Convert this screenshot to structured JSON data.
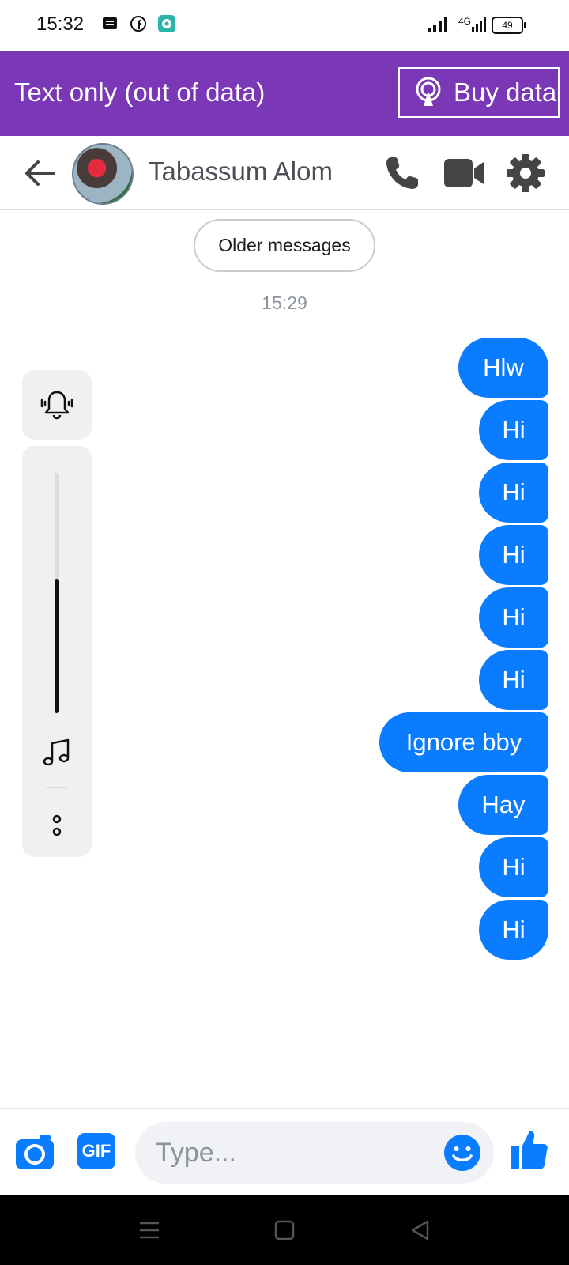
{
  "status_bar": {
    "time": "15:32",
    "network": "4G",
    "battery": "49"
  },
  "banner": {
    "text": "Text only (out of data)",
    "button_label": "Buy data",
    "color": "#7a37b6"
  },
  "header": {
    "contact_name": "Tabassum Alom",
    "icons": [
      "back-arrow-icon",
      "phone-icon",
      "video-camera-icon",
      "gear-icon"
    ]
  },
  "conversation": {
    "older_label": "Older messages",
    "timestamp": "15:29",
    "bubble_color": "#0a7cff",
    "messages": [
      {
        "text": "Hlw"
      },
      {
        "text": "Hi"
      },
      {
        "text": "Hi"
      },
      {
        "text": "Hi"
      },
      {
        "text": "Hi"
      },
      {
        "text": "Hi"
      },
      {
        "text": "Ignore bby"
      },
      {
        "text": "Hay"
      },
      {
        "text": "Hi"
      },
      {
        "text": "Hi"
      }
    ]
  },
  "sound_panel": {
    "volume_level": 0.56,
    "icons": [
      "bell-icon",
      "music-note-icon",
      "more-dots-icon"
    ]
  },
  "composer": {
    "placeholder": "Type...",
    "gif_label": "GIF",
    "icons": [
      "camera-icon",
      "gif-icon",
      "emoji-icon",
      "thumbs-up-icon"
    ]
  }
}
